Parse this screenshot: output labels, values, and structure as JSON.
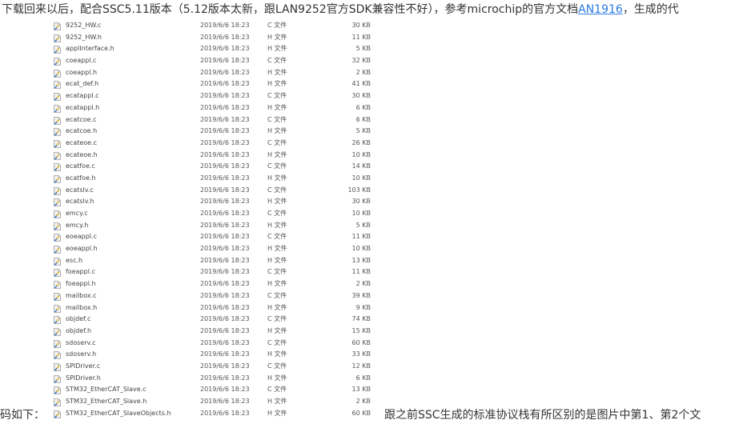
{
  "paragraph_top": {
    "text_before_link": "下载回来以后，配合SSC5.11版本（5.12版本太新，跟LAN9252官方SDK兼容性不好），参考microchip的官方文档",
    "link_text": "AN1916",
    "text_after_link": "，生成的代"
  },
  "paragraph_left": "码如下：",
  "paragraph_right": "跟之前SSC生成的标准协议栈有所区别的是图片中第1、第2个文",
  "files": [
    {
      "name": "9252_HW.c",
      "date": "2019/6/6 18:23",
      "type": "C 文件",
      "size": "30 KB"
    },
    {
      "name": "9252_HW.h",
      "date": "2019/6/6 18:23",
      "type": "H 文件",
      "size": "11 KB"
    },
    {
      "name": "applInterface.h",
      "date": "2019/6/6 18:23",
      "type": "H 文件",
      "size": "5 KB"
    },
    {
      "name": "coeappl.c",
      "date": "2019/6/6 18:23",
      "type": "C 文件",
      "size": "32 KB"
    },
    {
      "name": "coeappl.h",
      "date": "2019/6/6 18:23",
      "type": "H 文件",
      "size": "2 KB"
    },
    {
      "name": "ecat_def.h",
      "date": "2019/6/6 18:23",
      "type": "H 文件",
      "size": "41 KB"
    },
    {
      "name": "ecatappl.c",
      "date": "2019/6/6 18:23",
      "type": "C 文件",
      "size": "30 KB"
    },
    {
      "name": "ecatappl.h",
      "date": "2019/6/6 18:23",
      "type": "H 文件",
      "size": "6 KB"
    },
    {
      "name": "ecatcoe.c",
      "date": "2019/6/6 18:23",
      "type": "C 文件",
      "size": "6 KB"
    },
    {
      "name": "ecatcoe.h",
      "date": "2019/6/6 18:23",
      "type": "H 文件",
      "size": "5 KB"
    },
    {
      "name": "ecateoe.c",
      "date": "2019/6/6 18:23",
      "type": "C 文件",
      "size": "26 KB"
    },
    {
      "name": "ecateoe.h",
      "date": "2019/6/6 18:23",
      "type": "H 文件",
      "size": "10 KB"
    },
    {
      "name": "ecatfoe.c",
      "date": "2019/6/6 18:23",
      "type": "C 文件",
      "size": "14 KB"
    },
    {
      "name": "ecatfoe.h",
      "date": "2019/6/6 18:23",
      "type": "H 文件",
      "size": "10 KB"
    },
    {
      "name": "ecatslv.c",
      "date": "2019/6/6 18:23",
      "type": "C 文件",
      "size": "103 KB"
    },
    {
      "name": "ecatslv.h",
      "date": "2019/6/6 18:23",
      "type": "H 文件",
      "size": "30 KB"
    },
    {
      "name": "emcy.c",
      "date": "2019/6/6 18:23",
      "type": "C 文件",
      "size": "10 KB"
    },
    {
      "name": "emcy.h",
      "date": "2019/6/6 18:23",
      "type": "H 文件",
      "size": "5 KB"
    },
    {
      "name": "eoeappl.c",
      "date": "2019/6/6 18:23",
      "type": "C 文件",
      "size": "11 KB"
    },
    {
      "name": "eoeappl.h",
      "date": "2019/6/6 18:23",
      "type": "H 文件",
      "size": "10 KB"
    },
    {
      "name": "esc.h",
      "date": "2019/6/6 18:23",
      "type": "H 文件",
      "size": "13 KB"
    },
    {
      "name": "foeappl.c",
      "date": "2019/6/6 18:23",
      "type": "C 文件",
      "size": "11 KB"
    },
    {
      "name": "foeappl.h",
      "date": "2019/6/6 18:23",
      "type": "H 文件",
      "size": "2 KB"
    },
    {
      "name": "mailbox.c",
      "date": "2019/6/6 18:23",
      "type": "C 文件",
      "size": "39 KB"
    },
    {
      "name": "mailbox.h",
      "date": "2019/6/6 18:23",
      "type": "H 文件",
      "size": "9 KB"
    },
    {
      "name": "objdef.c",
      "date": "2019/6/6 18:23",
      "type": "C 文件",
      "size": "74 KB"
    },
    {
      "name": "objdef.h",
      "date": "2019/6/6 18:23",
      "type": "H 文件",
      "size": "15 KB"
    },
    {
      "name": "sdoserv.c",
      "date": "2019/6/6 18:23",
      "type": "C 文件",
      "size": "60 KB"
    },
    {
      "name": "sdoserv.h",
      "date": "2019/6/6 18:23",
      "type": "H 文件",
      "size": "33 KB"
    },
    {
      "name": "SPIDriver.c",
      "date": "2019/6/6 18:23",
      "type": "C 文件",
      "size": "12 KB"
    },
    {
      "name": "SPIDriver.h",
      "date": "2019/6/6 18:23",
      "type": "H 文件",
      "size": "6 KB"
    },
    {
      "name": "STM32_EtherCAT_Slave.c",
      "date": "2019/6/6 18:23",
      "type": "C 文件",
      "size": "13 KB"
    },
    {
      "name": "STM32_EtherCAT_Slave.h",
      "date": "2019/6/6 18:23",
      "type": "H 文件",
      "size": "2 KB"
    },
    {
      "name": "STM32_EtherCAT_SlaveObjects.h",
      "date": "2019/6/6 18:23",
      "type": "H 文件",
      "size": "60 KB"
    }
  ]
}
